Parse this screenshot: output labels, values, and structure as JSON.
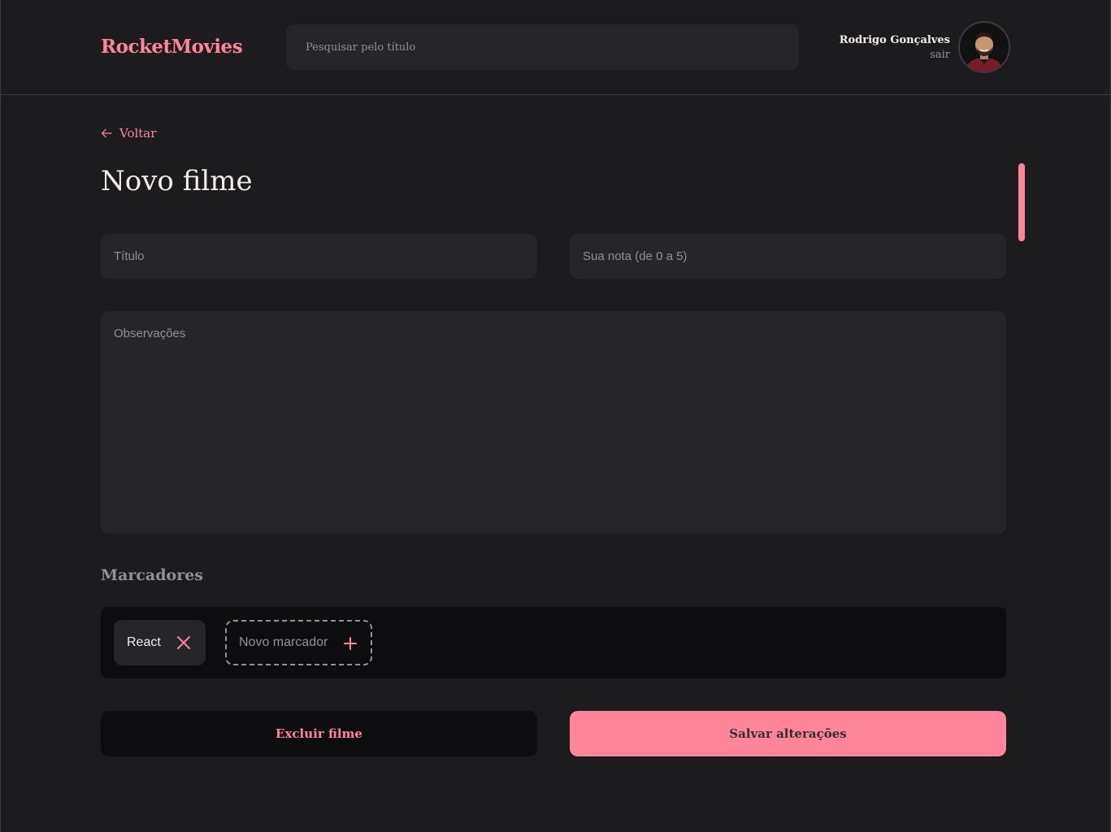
{
  "header": {
    "logo": "RocketMovies",
    "search_placeholder": "Pesquisar pelo título",
    "user": {
      "name": "Rodrigo Gonçalves",
      "signout": "sair"
    }
  },
  "nav": {
    "back_label": "Voltar"
  },
  "page": {
    "title": "Novo filme"
  },
  "form": {
    "title_placeholder": "Título",
    "rating_placeholder": "Sua nota (de 0 a 5)",
    "notes_placeholder": "Observações"
  },
  "tags": {
    "section_title": "Marcadores",
    "items": [
      {
        "label": "React"
      }
    ],
    "new_placeholder": "Novo marcador"
  },
  "actions": {
    "delete_label": "Excluir filme",
    "save_label": "Salvar alterações"
  },
  "colors": {
    "accent": "#ff859b",
    "background": "#1c1b1e",
    "input": "#262529",
    "dark": "#0d0c0f",
    "text": "#f4ede8",
    "muted": "#948f99"
  },
  "icons": {
    "back": "arrow-left-icon",
    "tag_remove": "close-icon",
    "tag_add": "plus-icon"
  }
}
